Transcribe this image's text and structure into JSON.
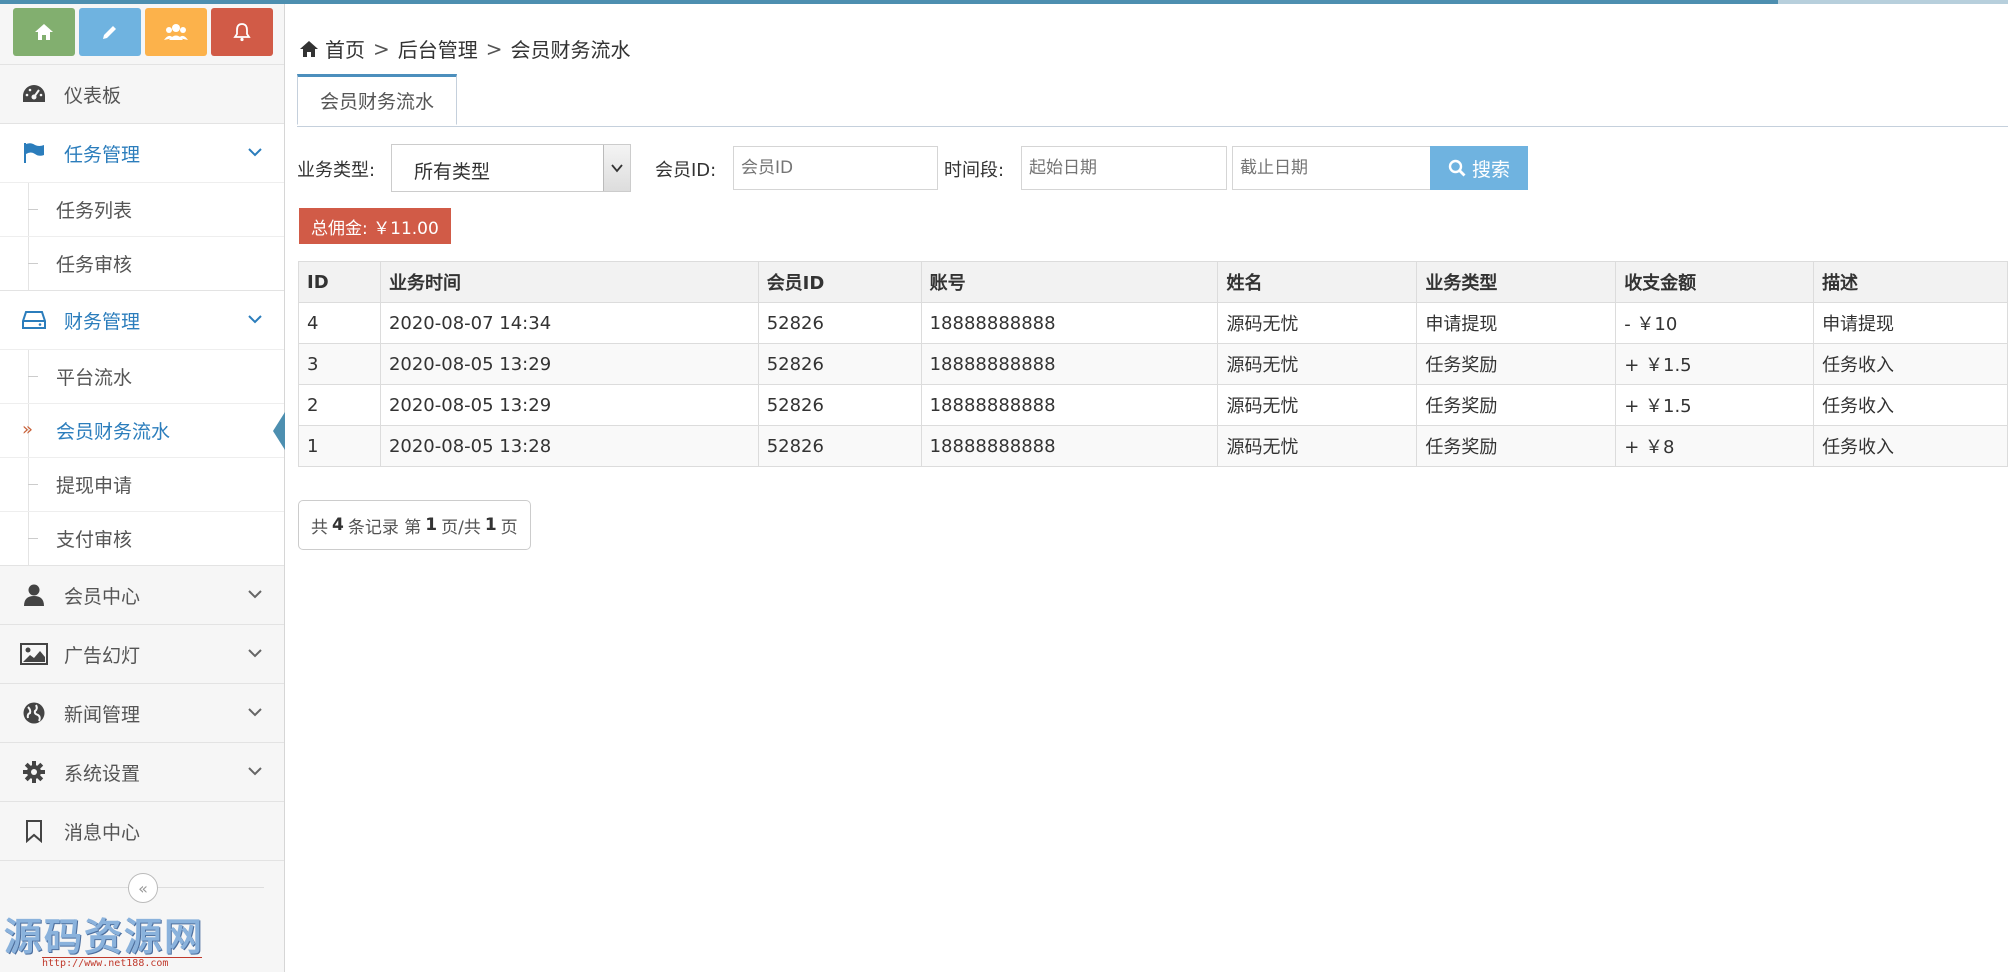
{
  "sidebar": {
    "shortcuts": [
      {
        "icon": "home-icon",
        "color": "#82af6f"
      },
      {
        "icon": "pencil-icon",
        "color": "#6fb3e0"
      },
      {
        "icon": "users-icon",
        "color": "#fcb24b"
      },
      {
        "icon": "bell-icon",
        "color": "#d15b47"
      }
    ],
    "dashboard": "仪表板",
    "task": {
      "label": "任务管理",
      "items": [
        "任务列表",
        "任务审核"
      ]
    },
    "finance": {
      "label": "财务管理",
      "items": [
        "平台流水",
        "会员财务流水",
        "提现申请",
        "支付审核"
      ],
      "active": "会员财务流水"
    },
    "member": "会员中心",
    "ads": "广告幻灯",
    "news": "新闻管理",
    "settings": "系统设置",
    "messages": "消息中心"
  },
  "watermark": {
    "title": "源码资源网",
    "url": "http://www.net188.com"
  },
  "breadcrumb": {
    "home": "首页",
    "admin": "后台管理",
    "current": "会员财务流水",
    "sep": ">"
  },
  "tab": {
    "label": "会员财务流水"
  },
  "filter": {
    "type_label": "业务类型:",
    "type_value": "所有类型",
    "member_label": "会员ID:",
    "member_placeholder": "会员ID",
    "period_label": "时间段:",
    "start_placeholder": "起始日期",
    "end_placeholder": "截止日期",
    "search_label": "搜索"
  },
  "total": {
    "text": "总佣金: ￥11.00"
  },
  "table": {
    "headers": [
      "ID",
      "业务时间",
      "会员ID",
      "账号",
      "姓名",
      "业务类型",
      "收支金额",
      "描述"
    ],
    "rows": [
      [
        "4",
        "2020-08-07 14:34",
        "52826",
        "18888888888",
        "源码无忧",
        "申请提现",
        "- ￥10",
        "申请提现"
      ],
      [
        "3",
        "2020-08-05 13:29",
        "52826",
        "18888888888",
        "源码无忧",
        "任务奖励",
        "+ ￥1.5",
        "任务收入"
      ],
      [
        "2",
        "2020-08-05 13:29",
        "52826",
        "18888888888",
        "源码无忧",
        "任务奖励",
        "+ ￥1.5",
        "任务收入"
      ],
      [
        "1",
        "2020-08-05 13:28",
        "52826",
        "18888888888",
        "源码无忧",
        "任务奖励",
        "+ ￥8",
        "任务收入"
      ]
    ]
  },
  "pager": {
    "t1": "共",
    "total": "4",
    "t2": "条记录 第",
    "page": "1",
    "t3": "页/共",
    "pages": "1",
    "t4": "页"
  },
  "colors": {
    "accent": "#2b7dbc",
    "danger": "#d15b47",
    "search": "#6fb3e0"
  }
}
